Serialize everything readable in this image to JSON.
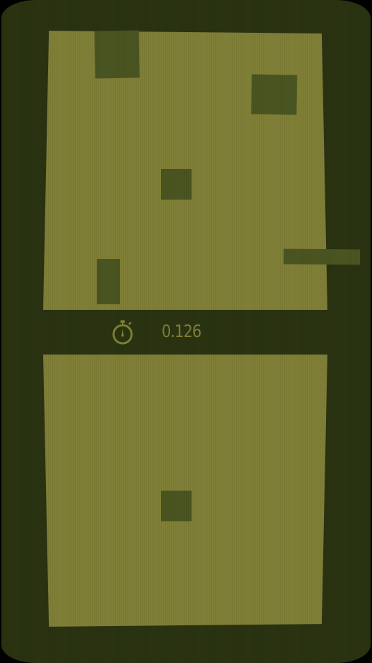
{
  "game": {
    "timer": "0.126",
    "colors": {
      "background": "#000000",
      "frame": "#2a3311",
      "field": "#7f7f37",
      "block": "#4a5522",
      "hud_text": "#7f7f37"
    },
    "icons": {
      "timer_icon": "stopwatch-icon"
    }
  }
}
